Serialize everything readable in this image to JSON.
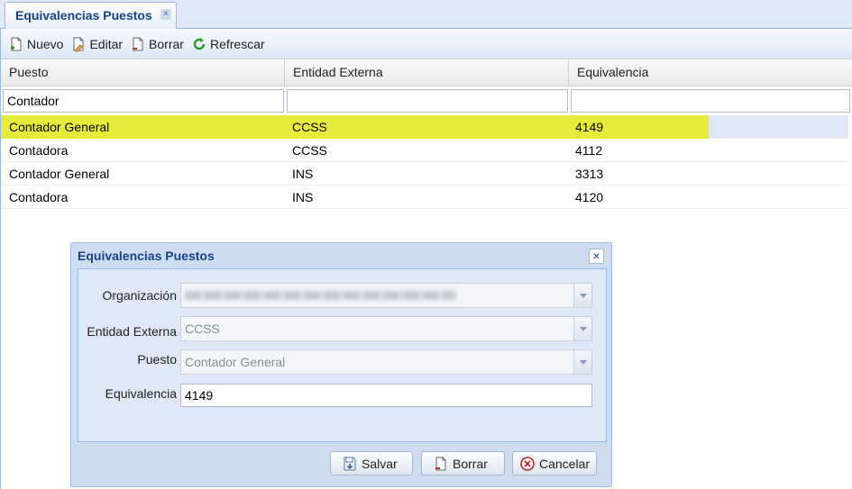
{
  "tab": {
    "title": "Equivalencias Puestos",
    "close_icon": "close-icon"
  },
  "toolbar": {
    "new_label": "Nuevo",
    "edit_label": "Editar",
    "delete_label": "Borrar",
    "refresh_label": "Refrescar"
  },
  "grid": {
    "columns": [
      "Puesto",
      "Entidad Externa",
      "Equivalencia"
    ],
    "filters": [
      "Contador",
      "",
      ""
    ],
    "rows": [
      [
        "Contador General",
        "CCSS",
        "4149"
      ],
      [
        "Contadora",
        "CCSS",
        "4112"
      ],
      [
        "Contador General",
        "INS",
        "3313"
      ],
      [
        "Contadora",
        "INS",
        "4120"
      ]
    ],
    "highlight_color": "#e6ec3a"
  },
  "dialog": {
    "title": "Equivalencias Puestos",
    "fields": {
      "org_label": "Organización",
      "entity_label": "Entidad Externa",
      "entity_value": "CCSS",
      "position_label": "Puesto",
      "position_value": "Contador General",
      "equiv_label": "Equivalencia",
      "equiv_value": "4149"
    },
    "buttons": {
      "save_label": "Salvar",
      "delete_label": "Borrar",
      "cancel_label": "Cancelar"
    }
  }
}
